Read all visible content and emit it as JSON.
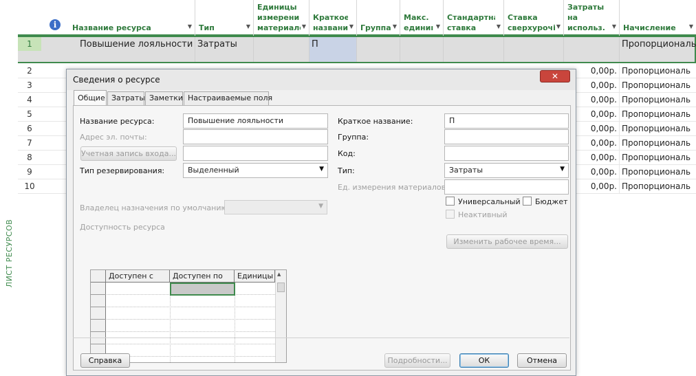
{
  "sheet_side_label": "ЛИСТ РЕСУРСОВ",
  "columns": [
    {
      "label": "Название ресурса"
    },
    {
      "label": "Тип"
    },
    {
      "label": "Единицы\nизмерени\nматериалс"
    },
    {
      "label": "Краткое\nназвани"
    },
    {
      "label": "Группа"
    },
    {
      "label": "Макс.\nединиı"
    },
    {
      "label": "Стандартна\nставка"
    },
    {
      "label": "Ставка\nсверхурочі"
    },
    {
      "label": "Затраты\nна\nиспольз."
    },
    {
      "label": "Начисление"
    }
  ],
  "row1": {
    "num": "1",
    "name": "Повышение лояльности",
    "type": "Затраты",
    "short": "П",
    "accrual": "Пропорциональ"
  },
  "rows": [
    {
      "num": "2",
      "cost": "0,00р.",
      "accrual": "Пропорциональ"
    },
    {
      "num": "3",
      "cost": "0,00р.",
      "accrual": "Пропорциональ"
    },
    {
      "num": "4",
      "cost": "0,00р.",
      "accrual": "Пропорциональ"
    },
    {
      "num": "5",
      "cost": "0,00р.",
      "accrual": "Пропорциональ"
    },
    {
      "num": "6",
      "cost": "0,00р.",
      "accrual": "Пропорциональ"
    },
    {
      "num": "7",
      "cost": "0,00р.",
      "accrual": "Пропорциональ"
    },
    {
      "num": "8",
      "cost": "0,00р.",
      "accrual": "Пропорциональ"
    },
    {
      "num": "9",
      "cost": "0,00р.",
      "accrual": "Пропорциональ"
    },
    {
      "num": "10",
      "cost": "0,00р.",
      "accrual": "Пропорциональ"
    }
  ],
  "dialog": {
    "title": "Сведения о ресурсе",
    "close_label": "✕",
    "tabs": [
      "Общие",
      "Затраты",
      "Заметки",
      "Настраиваемые поля"
    ],
    "name_label": "Название ресурса:",
    "name_value": "Повышение лояльности",
    "email_label": "Адрес эл. почты:",
    "email_value": "",
    "account_button": "Учетная запись входа...",
    "account_value": "",
    "booking_label": "Тип резервирования:",
    "booking_value": "Выделенный",
    "owner_label": "Владелец назначения по умолчанию:",
    "owner_value": "",
    "availability_label": "Доступность ресурса",
    "avail_headers": [
      "Доступен с",
      "Доступен по",
      "Единицы"
    ],
    "short_label": "Краткое название:",
    "short_value": "П",
    "group_label": "Группа:",
    "group_value": "",
    "code_label": "Код:",
    "code_value": "",
    "type_label": "Тип:",
    "type_value": "Затраты",
    "material_label": "Ед. измерения материалов:",
    "material_value": "",
    "generic_label": "Универсальный",
    "budget_label": "Бюджет",
    "inactive_label": "Неактивный",
    "work_time_button": "Изменить рабочее время...",
    "help_button": "Справка",
    "details_button": "Подробности...",
    "ok_button": "ОК",
    "cancel_button": "Отмена"
  }
}
